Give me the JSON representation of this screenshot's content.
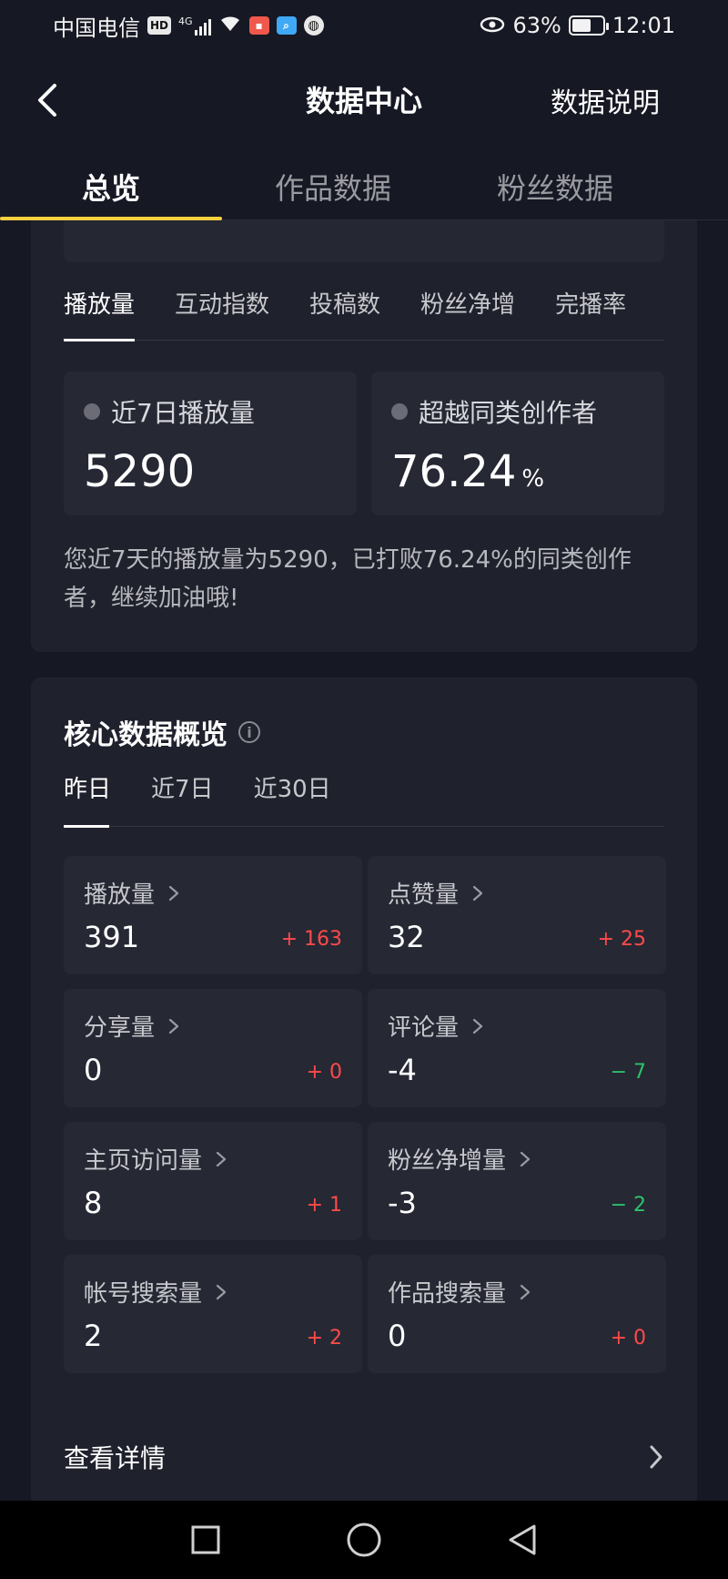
{
  "status_bar": {
    "carrier": "中国电信",
    "hd_badge": "HD",
    "signal": "4G",
    "eye_icon": "eye-icon",
    "battery_percent": "63%",
    "battery_level": 0.63,
    "time": "12:01"
  },
  "header": {
    "title": "数据中心",
    "right_action": "数据说明"
  },
  "top_tabs": [
    {
      "label": "总览",
      "active": true
    },
    {
      "label": "作品数据",
      "active": false
    },
    {
      "label": "粉丝数据",
      "active": false
    }
  ],
  "metric_tabs": [
    {
      "label": "播放量",
      "active": true
    },
    {
      "label": "互动指数",
      "active": false
    },
    {
      "label": "投稿数",
      "active": false
    },
    {
      "label": "粉丝净增",
      "active": false
    },
    {
      "label": "完播率",
      "active": false
    }
  ],
  "overview": {
    "left": {
      "label": "近7日播放量",
      "value": "5290"
    },
    "right": {
      "label": "超越同类创作者",
      "value": "76.24",
      "unit": "%"
    },
    "summary": "您近7天的播放量为5290，已打败76.24%的同类创作者，继续加油哦!"
  },
  "core": {
    "title": "核心数据概览",
    "period_tabs": [
      {
        "label": "昨日",
        "active": true
      },
      {
        "label": "近7日",
        "active": false
      },
      {
        "label": "近30日",
        "active": false
      }
    ],
    "cells": [
      {
        "label": "播放量",
        "value": "391",
        "delta": "+ 163",
        "trend": "up"
      },
      {
        "label": "点赞量",
        "value": "32",
        "delta": "+ 25",
        "trend": "up"
      },
      {
        "label": "分享量",
        "value": "0",
        "delta": "+ 0",
        "trend": "up"
      },
      {
        "label": "评论量",
        "value": "-4",
        "delta": "− 7",
        "trend": "down"
      },
      {
        "label": "主页访问量",
        "value": "8",
        "delta": "+ 1",
        "trend": "up"
      },
      {
        "label": "粉丝净增量",
        "value": "-3",
        "delta": "− 2",
        "trend": "down"
      },
      {
        "label": "帐号搜索量",
        "value": "2",
        "delta": "+ 2",
        "trend": "up"
      },
      {
        "label": "作品搜索量",
        "value": "0",
        "delta": "+ 0",
        "trend": "up"
      }
    ],
    "details_label": "查看详情"
  },
  "colors": {
    "background": "#161823",
    "card": "#1f212c",
    "tab_indicator": "#fcd040",
    "positive": "#fe4a4a",
    "negative": "#2cc36b"
  }
}
